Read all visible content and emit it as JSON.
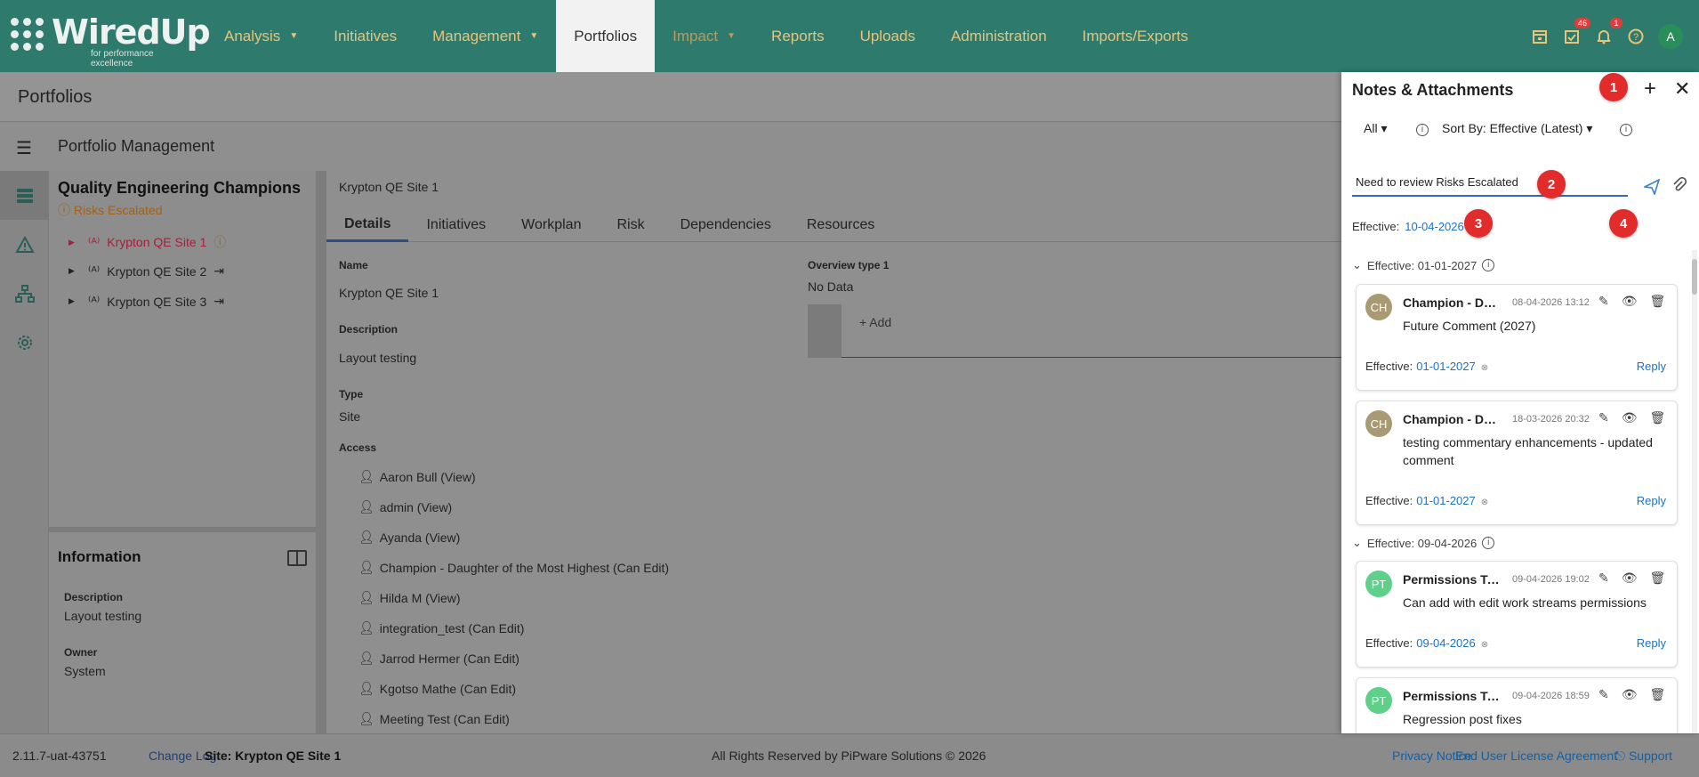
{
  "brand": {
    "name": "WiredUp",
    "tagline": "for performance excellence"
  },
  "nav": [
    {
      "label": "Analysis",
      "caret": true
    },
    {
      "label": "Initiatives",
      "caret": false
    },
    {
      "label": "Management",
      "caret": true
    },
    {
      "label": "Portfolios",
      "caret": false,
      "active": true
    },
    {
      "label": "Impact",
      "caret": true,
      "dim": true
    },
    {
      "label": "Reports",
      "caret": false
    },
    {
      "label": "Uploads",
      "caret": false
    },
    {
      "label": "Administration",
      "caret": false
    },
    {
      "label": "Imports/Exports",
      "caret": false
    }
  ],
  "top_icons": {
    "tasks_badge": "46",
    "bell_badge": "1",
    "avatar": "A"
  },
  "page": {
    "title": "Portfolios",
    "subtitle": "Portfolio Management"
  },
  "tree": {
    "title": "Quality Engineering Champions",
    "warning": "Risks Escalated",
    "items": [
      {
        "label": "Krypton QE Site 1",
        "selected": true
      },
      {
        "label": "Krypton QE Site 2"
      },
      {
        "label": "Krypton QE Site 3"
      }
    ]
  },
  "info": {
    "title": "Information",
    "description_label": "Description",
    "description": "Layout testing",
    "owner_label": "Owner",
    "owner": "System"
  },
  "main": {
    "breadcrumb": "Krypton QE Site 1",
    "tabs": [
      "Details",
      "Initiatives",
      "Workplan",
      "Risk",
      "Dependencies",
      "Resources"
    ],
    "name_label": "Name",
    "name": "Krypton QE Site 1",
    "description_label": "Description",
    "description": "Layout testing",
    "type_label": "Type",
    "type": "Site",
    "access_label": "Access",
    "access": [
      "Aaron Bull (View)",
      "admin (View)",
      "Ayanda (View)",
      "Champion - Daughter of the Most Highest (Can Edit)",
      "Hilda M (View)",
      "integration_test (Can Edit)",
      "Jarrod Hermer (Can Edit)",
      "Kgotso Mathe (Can Edit)",
      "Meeting Test (Can Edit)"
    ],
    "overview_label": "Overview type 1",
    "overview_value": "No Data",
    "add_label": "+ Add"
  },
  "footer": {
    "version": "2.11.7-uat-43751",
    "changelog": "Change Log",
    "site": "Site: Krypton QE Site 1",
    "copyright": "All Rights Reserved by PiPware Solutions © 2026",
    "privacy": "Privacy Notice",
    "eula": "End User License Agreement",
    "support": "Support"
  },
  "panel": {
    "title": "Notes & Attachments",
    "filter": "All",
    "sort": "Sort By: Effective (Latest)",
    "input_value": "Need to review Risks Escalated",
    "effective_label": "Effective:",
    "effective_date": "10-04-2026",
    "markers": [
      "1",
      "2",
      "3",
      "4"
    ],
    "groups": [
      {
        "label": "Effective: 01-01-2027"
      },
      {
        "label": "Effective: 09-04-2026"
      }
    ],
    "cards": [
      {
        "initials": "CH",
        "color": "#a89a72",
        "name": "Champion - Dau...",
        "date": "08-04-2026 13:12",
        "text": "Future Comment (2027)",
        "eff": "01-01-2027",
        "reply": "Reply"
      },
      {
        "initials": "CH",
        "color": "#a89a72",
        "name": "Champion - Dau...",
        "date": "18-03-2026 20:32",
        "text": "testing commentary enhancements - updated comment",
        "eff": "01-01-2027",
        "reply": "Reply"
      },
      {
        "initials": "PT",
        "color": "#5fd08a",
        "name": "Permissions Te...",
        "date": "09-04-2026 19:02",
        "text": "Can add with edit work streams permissions",
        "eff": "09-04-2026",
        "reply": "Reply"
      },
      {
        "initials": "PT",
        "color": "#5fd08a",
        "name": "Permissions Te...",
        "date": "09-04-2026 18:59",
        "text": "Regression post fixes",
        "eff": "",
        "reply": ""
      }
    ],
    "effective_prefix": "Effective:"
  }
}
